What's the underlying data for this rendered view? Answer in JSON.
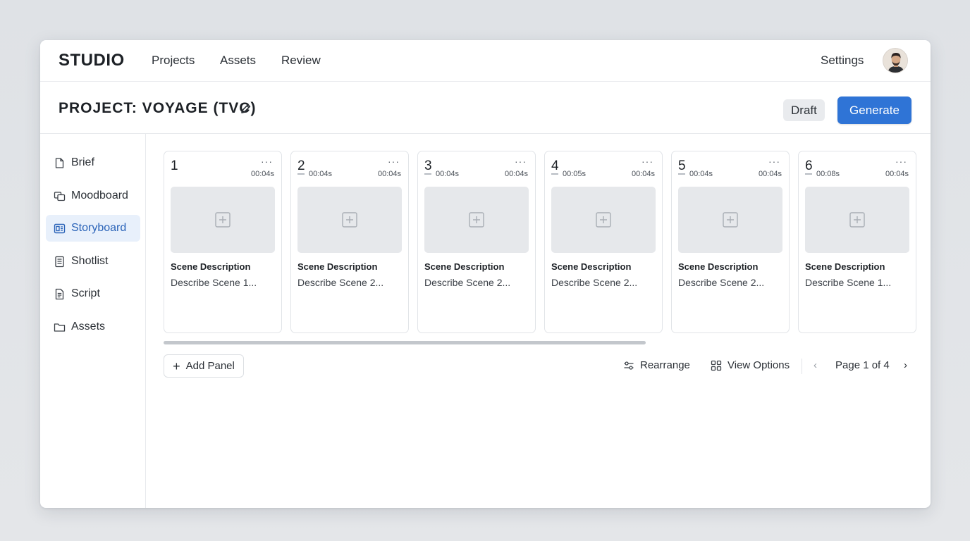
{
  "app": {
    "brand": "STUDIO",
    "nav": [
      "Projects",
      "Assets",
      "Review"
    ],
    "settings_label": "Settings"
  },
  "project": {
    "title": "PROJECT: VOYAGE (TVC)",
    "status_badge": "Draft",
    "generate_label": "Generate"
  },
  "sidebar": {
    "items": [
      {
        "label": "Brief",
        "icon": "brief-icon",
        "active": false
      },
      {
        "label": "Moodboard",
        "icon": "moodboard-icon",
        "active": false
      },
      {
        "label": "Storyboard",
        "icon": "storyboard-icon",
        "active": true
      },
      {
        "label": "Shotlist",
        "icon": "shotlist-icon",
        "active": false
      },
      {
        "label": "Script",
        "icon": "script-icon",
        "active": false
      },
      {
        "label": "Assets",
        "icon": "folder-icon",
        "active": false
      }
    ]
  },
  "panels": [
    {
      "number": "1",
      "time_left": "",
      "time_right": "00:04s",
      "title": "Scene Description",
      "description": "Describe Scene 1..."
    },
    {
      "number": "2",
      "time_left": "00:04s",
      "time_right": "00:04s",
      "title": "Scene Description",
      "description": "Describe Scene 2..."
    },
    {
      "number": "3",
      "time_left": "00:04s",
      "time_right": "00:04s",
      "title": "Scene Description",
      "description": "Describe Scene 2..."
    },
    {
      "number": "4",
      "time_left": "00:05s",
      "time_right": "00:04s",
      "title": "Scene Description",
      "description": "Describe Scene 2..."
    },
    {
      "number": "5",
      "time_left": "00:04s",
      "time_right": "00:04s",
      "title": "Scene Description",
      "description": "Describe Scene 2..."
    },
    {
      "number": "6",
      "time_left": "00:08s",
      "time_right": "00:04s",
      "title": "Scene Description",
      "description": "Describe Scene 1..."
    }
  ],
  "panel_menu_glyph": "···",
  "toolbar": {
    "add_panel_label": "Add Panel",
    "rearrange_label": "Rearrange",
    "view_options_label": "View Options",
    "pagination": "Page 1 of 4",
    "prev_glyph": "‹",
    "next_glyph": "›"
  },
  "colors": {
    "accent": "#2f74d6",
    "active_bg": "#e8f0fb",
    "active_text": "#2a63b8"
  }
}
